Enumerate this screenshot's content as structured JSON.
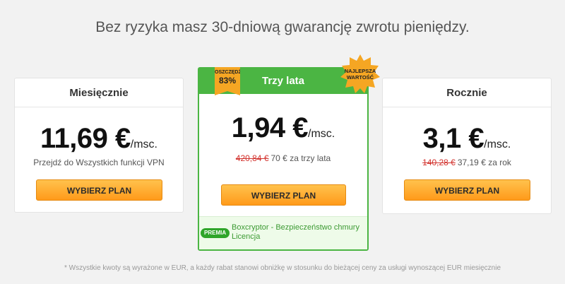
{
  "headline": "Bez ryzyka masz 30-dniową gwarancję zwrotu pieniędzy.",
  "plans": {
    "monthly": {
      "title": "Miesięcznie",
      "price": "11,69 €",
      "per": "/msc.",
      "note": "Przejdź do Wszystkich funkcji VPN",
      "button": "WYBIERZ PLAN"
    },
    "three_year": {
      "title": "Trzy lata",
      "price": "1,94 €",
      "per": "/msc.",
      "old_price": "420,84 €",
      "note": "70 € za trzy lata",
      "button": "WYBIERZ PLAN",
      "discount_label": "OSZCZĘDŹ",
      "discount_value": "83%",
      "badge_line1": "NAJLEPSZA",
      "badge_line2": "WARTOŚĆ",
      "extra_tag": "PREMIA",
      "extra_line1": "Boxcryptor - Bezpieczeństwo chmury",
      "extra_line2": "Licencja"
    },
    "yearly": {
      "title": "Rocznie",
      "price": "3,1 €",
      "per": "/msc.",
      "old_price": "140,28 €",
      "note": "37,19 € za rok",
      "button": "WYBIERZ PLAN"
    }
  },
  "footnote": "* Wszystkie kwoty są wyrażone w EUR, a każdy rabat stanowi obniżkę w stosunku do bieżącej ceny za usługi wynoszącej EUR miesięcznie",
  "colors": {
    "accent_green": "#4bb543",
    "button_orange": "#ff9a1a",
    "strike_red": "#d2322d",
    "badge_yellow": "#f5a623"
  }
}
